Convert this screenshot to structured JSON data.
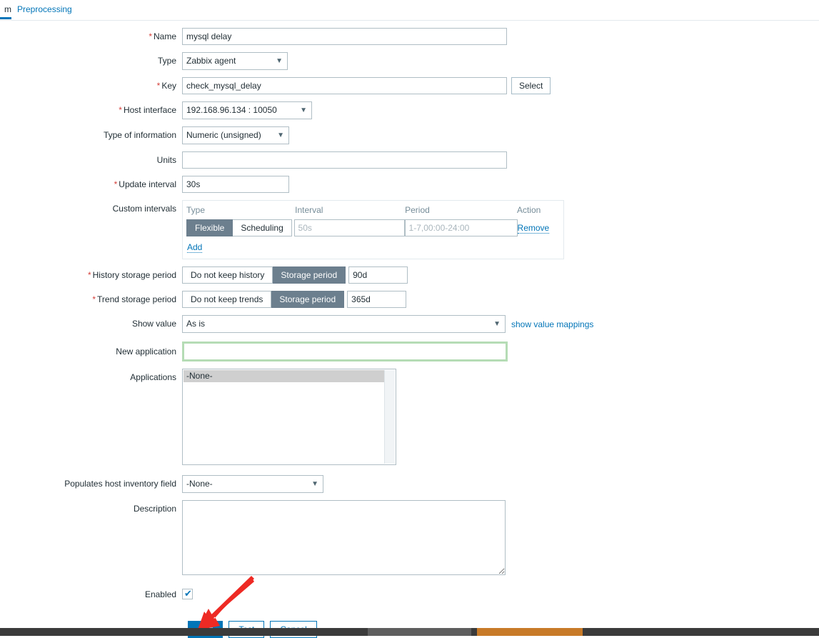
{
  "tabs": [
    {
      "label": "m",
      "active": true
    },
    {
      "label": "Preprocessing",
      "active": false
    }
  ],
  "form": {
    "name": {
      "label": "Name",
      "required": true,
      "value": "mysql delay"
    },
    "type": {
      "label": "Type",
      "required": false,
      "value": "Zabbix agent",
      "chevron": "chevron-down-icon"
    },
    "key": {
      "label": "Key",
      "required": true,
      "value": "check_mysql_delay",
      "select_button": "Select"
    },
    "host_interface": {
      "label": "Host interface",
      "required": true,
      "value": "192.168.96.134 : 10050"
    },
    "type_of_information": {
      "label": "Type of information",
      "required": false,
      "value": "Numeric (unsigned)"
    },
    "units": {
      "label": "Units",
      "required": false,
      "value": ""
    },
    "update_interval": {
      "label": "Update interval",
      "required": true,
      "value": "30s"
    },
    "custom_intervals": {
      "label": "Custom intervals",
      "columns": [
        "Type",
        "Interval",
        "Period",
        "Action"
      ],
      "rows": [
        {
          "type_options": [
            "Flexible",
            "Scheduling"
          ],
          "type_selected": "Flexible",
          "interval_value": "",
          "interval_placeholder": "50s",
          "period_value": "",
          "period_placeholder": "1-7,00:00-24:00",
          "action": "Remove"
        }
      ],
      "add_link": "Add"
    },
    "history_storage_period": {
      "label": "History storage period",
      "required": true,
      "options": [
        "Do not keep history",
        "Storage period"
      ],
      "selected": "Storage period",
      "value": "90d"
    },
    "trend_storage_period": {
      "label": "Trend storage period",
      "required": true,
      "options": [
        "Do not keep trends",
        "Storage period"
      ],
      "selected": "Storage period",
      "value": "365d"
    },
    "show_value": {
      "label": "Show value",
      "required": false,
      "value": "As is",
      "link": "show value mappings"
    },
    "new_application": {
      "label": "New application",
      "required": false,
      "value": "",
      "focused": true
    },
    "applications": {
      "label": "Applications",
      "items": [
        "-None-"
      ],
      "selected": "-None-"
    },
    "host_inventory_field": {
      "label": "Populates host inventory field",
      "required": false,
      "value": "-None-"
    },
    "description": {
      "label": "Description",
      "required": false,
      "value": ""
    },
    "enabled": {
      "label": "Enabled",
      "checked": true,
      "tick": "✔"
    }
  },
  "footer": {
    "add": "Add",
    "test": "Test",
    "cancel": "Cancel"
  },
  "colors": {
    "accent": "#0275b8",
    "required": "#d43f3a",
    "toggle_on": "#6c7f8e",
    "focus_ring": "#b5dcb5",
    "annotation": "#ee2a24",
    "taskbar": "#3b3b3b",
    "taskbar_highlight": "#c87a28"
  }
}
